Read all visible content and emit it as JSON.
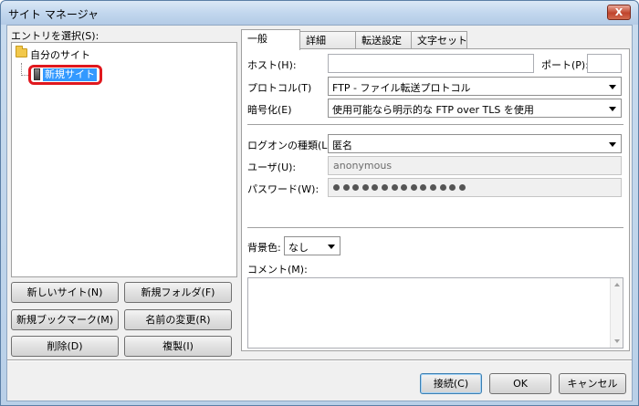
{
  "window": {
    "title": "サイト マネージャ",
    "close_glyph": "X"
  },
  "left": {
    "entry_label": "エントリを選択(S):",
    "tree": {
      "root_label": "自分のサイト",
      "child_label": "新規サイト"
    },
    "buttons": {
      "new_site": "新しいサイト(N)",
      "new_folder": "新規フォルダ(F)",
      "new_bookmark": "新規ブックマーク(M)",
      "rename": "名前の変更(R)",
      "delete": "削除(D)",
      "duplicate": "複製(I)"
    }
  },
  "tabs": [
    "一般",
    "詳細",
    "転送設定",
    "文字セット"
  ],
  "general": {
    "host_label": "ホスト(H):",
    "host_value": "",
    "port_label": "ポート(P):",
    "port_value": "",
    "protocol_label": "プロトコル(T)",
    "protocol_value": "FTP - ファイル転送プロトコル",
    "encryption_label": "暗号化(E)",
    "encryption_value": "使用可能なら明示的な FTP over TLS を使用",
    "logon_label": "ログオンの種類(L):",
    "logon_value": "匿名",
    "user_label": "ユーザ(U):",
    "user_value": "anonymous",
    "password_label": "パスワード(W):",
    "password_dot_count": 14,
    "bgcolor_label": "背景色:",
    "bgcolor_value": "なし",
    "comment_label": "コメント(M):",
    "comment_value": ""
  },
  "footer": {
    "connect": "接続(C)",
    "ok": "OK",
    "cancel": "キャンセル"
  }
}
